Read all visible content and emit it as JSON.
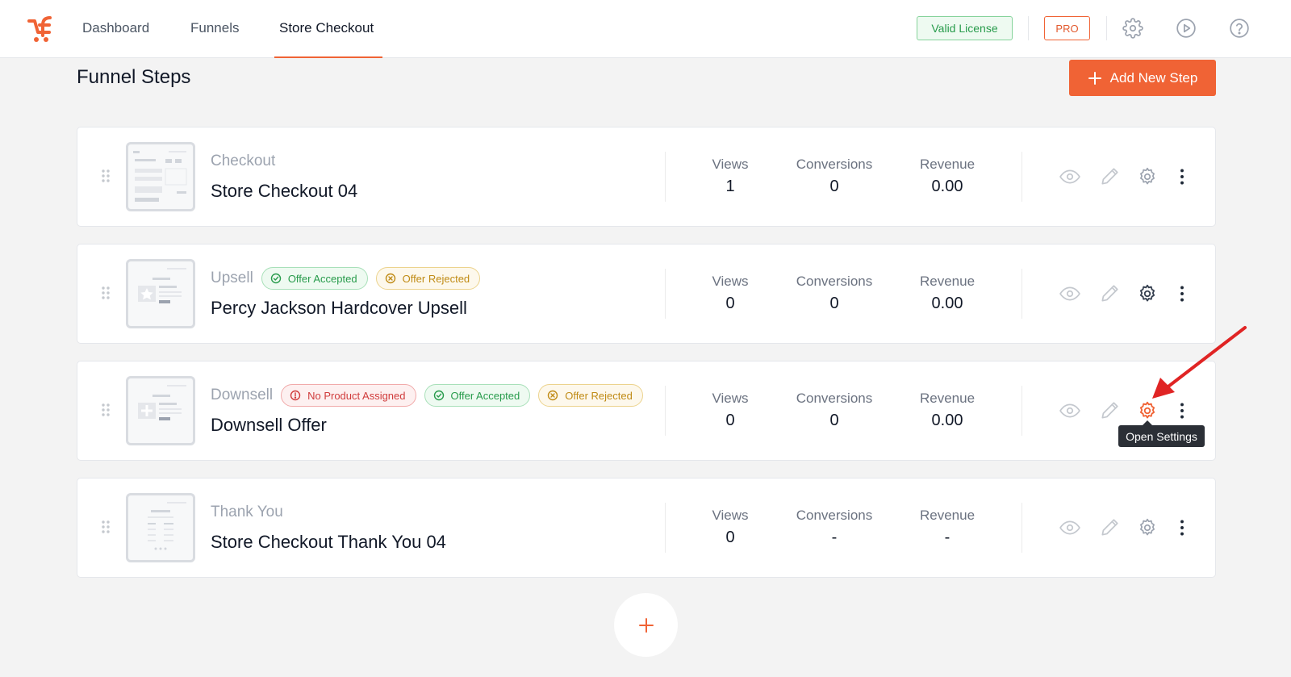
{
  "nav": {
    "items": [
      {
        "label": "Dashboard"
      },
      {
        "label": "Funnels"
      },
      {
        "label": "Store Checkout",
        "active": true
      }
    ],
    "license_label": "Valid License",
    "pro_label": "PRO",
    "icons": [
      "gear-icon",
      "play-icon",
      "help-icon"
    ]
  },
  "header": {
    "title": "Funnel Steps",
    "add_button_label": "Add New Step"
  },
  "stat_labels": {
    "views": "Views",
    "conversions": "Conversions",
    "revenue": "Revenue"
  },
  "steps": [
    {
      "type": "Checkout",
      "name": "Store Checkout 04",
      "badges": [],
      "views": "1",
      "conversions": "0",
      "revenue": "0.00"
    },
    {
      "type": "Upsell",
      "name": "Percy Jackson Hardcover Upsell",
      "badges": [
        "Offer Accepted",
        "Offer Rejected"
      ],
      "views": "0",
      "conversions": "0",
      "revenue": "0.00"
    },
    {
      "type": "Downsell",
      "name": "Downsell Offer",
      "badges": [
        "No Product Assigned",
        "Offer Accepted",
        "Offer Rejected"
      ],
      "views": "0",
      "conversions": "0",
      "revenue": "0.00"
    },
    {
      "type": "Thank You",
      "name": "Store Checkout Thank You 04",
      "badges": [],
      "views": "0",
      "conversions": "-",
      "revenue": "-"
    }
  ],
  "tooltip": "Open Settings",
  "colors": {
    "accent": "#f06335",
    "success": "#279b4b",
    "warning": "#c08b15",
    "danger": "#d03c3c",
    "annotation_arrow": "#e02424"
  }
}
